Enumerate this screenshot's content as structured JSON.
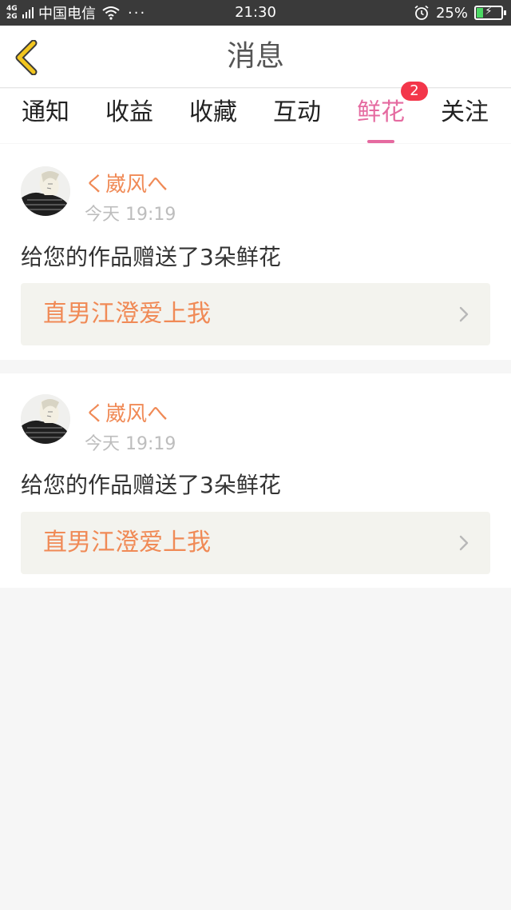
{
  "status_bar": {
    "network_top": "4G",
    "network_bottom": "2G",
    "carrier": "中国电信",
    "more": "···",
    "time": "21:30",
    "battery_percent": "25%",
    "battery_level": 0.25,
    "icons": [
      "signal-icon",
      "wifi-icon",
      "alarm-icon",
      "battery-icon"
    ]
  },
  "header": {
    "title": "消息",
    "back_icon": "chevron-left-icon"
  },
  "tabs": [
    {
      "label": "通知",
      "active": false
    },
    {
      "label": "收益",
      "active": false
    },
    {
      "label": "收藏",
      "active": false
    },
    {
      "label": "互动",
      "active": false
    },
    {
      "label": "鲜花",
      "active": true,
      "badge": "2"
    },
    {
      "label": "关注",
      "active": false
    }
  ],
  "messages": [
    {
      "user": "く崴风へ",
      "time": "今天 19:19",
      "text": "给您的作品赠送了3朵鲜花",
      "work_title": "直男江澄爱上我"
    },
    {
      "user": "く崴风へ",
      "time": "今天 19:19",
      "text": "给您的作品赠送了3朵鲜花",
      "work_title": "直男江澄爱上我"
    }
  ],
  "colors": {
    "accent_pink": "#e56aa0",
    "username_orange": "#f08a56",
    "badge_red": "#f3364a",
    "back_icon_yellow": "#f2c61f"
  }
}
